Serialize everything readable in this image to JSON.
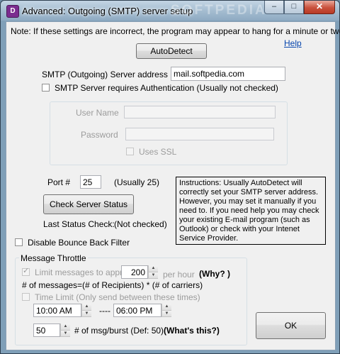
{
  "window": {
    "title": "Advanced:  Outgoing (SMTP) server setup",
    "watermark": "SOFTPEDIA",
    "app_icon_glyph": "D",
    "minimize_glyph": "–",
    "maximize_glyph": "□",
    "close_glyph": "✕"
  },
  "note": "Note:  If these settings are incorrect, the program may appear to hang for a minute or two.",
  "help_link": "Help",
  "autodetect_label": "AutoDetect",
  "smtp": {
    "label": "SMTP (Outgoing) Server address",
    "value": "mail.softpedia.com"
  },
  "auth": {
    "label": "SMTP Server requires Authentication  (Usually not checked)",
    "checked": false
  },
  "credentials": {
    "user_label": "User Name",
    "user_value": "",
    "password_label": "Password",
    "password_value": "",
    "ssl_label": "Uses SSL"
  },
  "port": {
    "label": "Port #",
    "value": "25",
    "hint": "(Usually 25)"
  },
  "check_status_label": "Check Server Status",
  "last_status": {
    "label": "Last Status Check:",
    "value": "(Not checked)"
  },
  "instructions": "Instructions:  Usually AutoDetect will correctly set your SMTP server address.  However, you may set it manually if you need to.  If you need help you may check your existing E-mail program (such as Outlook) or check with your Intenet Service Provider.",
  "bounce": {
    "label": "Disable Bounce Back Filter",
    "checked": false
  },
  "throttle": {
    "legend": "Message Throttle",
    "limit_label": "Limit messages to approx",
    "limit_checked": true,
    "limit_value": "200",
    "per_hour": "per hour",
    "why": "(Why? )",
    "formula": "# of messages=(# of Recipients) * (# of carriers)",
    "time_limit_label": "Time Limit (Only send between these times)",
    "time_limit_checked": false,
    "start_time": "10:00 AM",
    "separator": "----",
    "end_time": "06:00 PM",
    "burst_value": "50",
    "burst_label": "# of msg/burst (Def: 50)",
    "whats_this": "(What's this?)"
  },
  "ok_label": "OK"
}
